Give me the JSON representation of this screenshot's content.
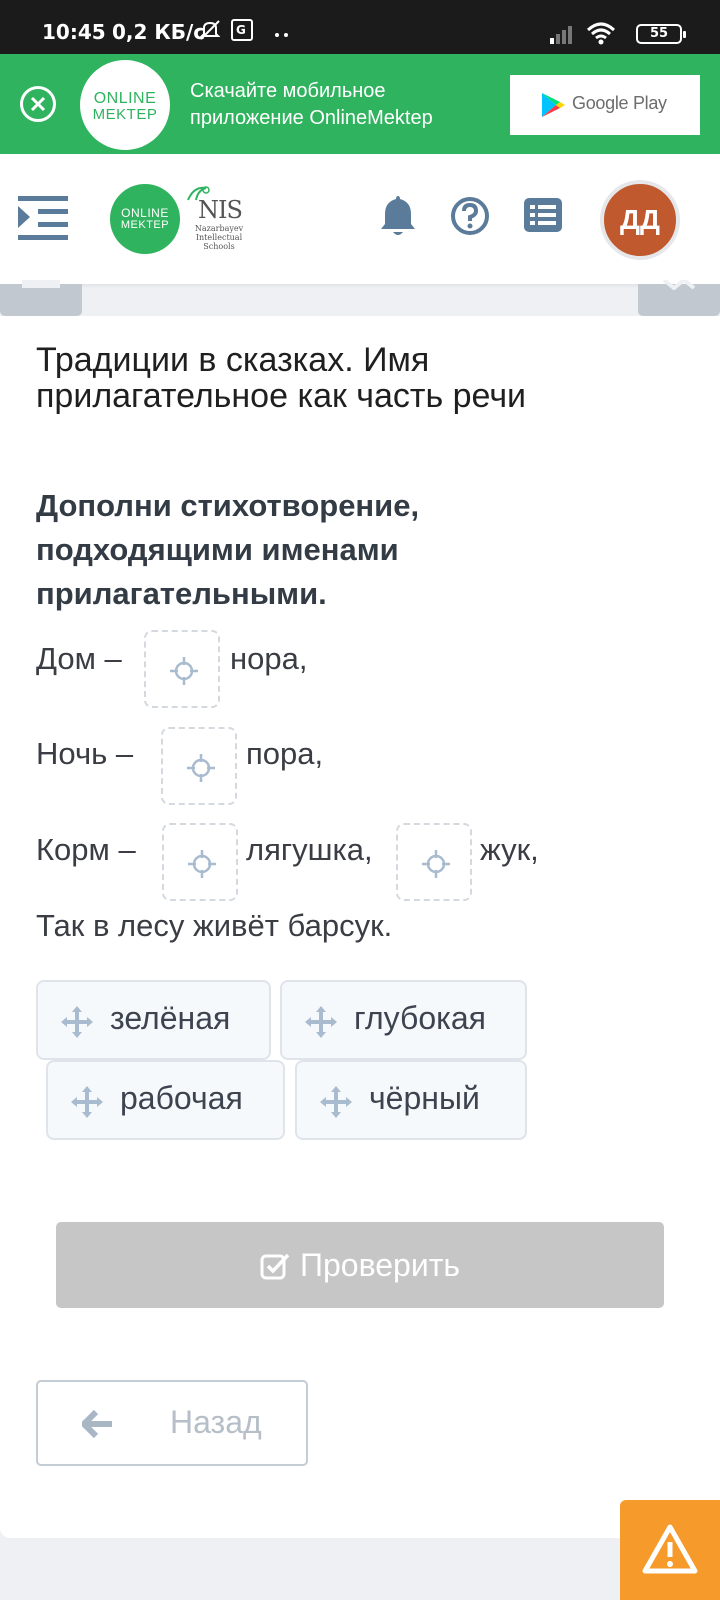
{
  "status_bar": {
    "time": "10:45",
    "network_speed": "0,2 КБ/с",
    "battery": "55"
  },
  "banner": {
    "logo_line1": "ONLINE",
    "logo_line2": "MEKTEP",
    "text": "Скачайте мобильное приложение OnlineMektep",
    "store_label": "Google Play"
  },
  "header": {
    "logo_line1": "ONLINE",
    "logo_line2": "MEKTEP",
    "partner_big": "NIS",
    "partner_line1": "Nazarbayev",
    "partner_line2": "Intellectual",
    "partner_line3": "Schools",
    "avatar_initials": "ДД",
    "icons": [
      "menu-icon",
      "bell-icon",
      "help-icon",
      "list-icon"
    ]
  },
  "lesson": {
    "title": "Традиции в сказках. Имя прилагательное как часть речи",
    "task": "Дополни стихотворение, подходящими именами прилагательными."
  },
  "poem": {
    "line1_start": "Дом –",
    "line1_end": "нора,",
    "line2_start": "Ночь –",
    "line2_end": "пора,",
    "line3_start": "Корм –",
    "line3_mid": "лягушка,",
    "line3_end": "жук,",
    "line4": "Так в лесу живёт барсук."
  },
  "options": [
    "зелёная",
    "глубокая",
    "рабочая",
    "чёрный"
  ],
  "buttons": {
    "check": "Проверить",
    "back": "Назад"
  },
  "colors": {
    "brand_green": "#2fb35e",
    "avatar": "#c05a2e",
    "warning": "#f59a2b",
    "disabled_button": "#c6c6c6"
  }
}
